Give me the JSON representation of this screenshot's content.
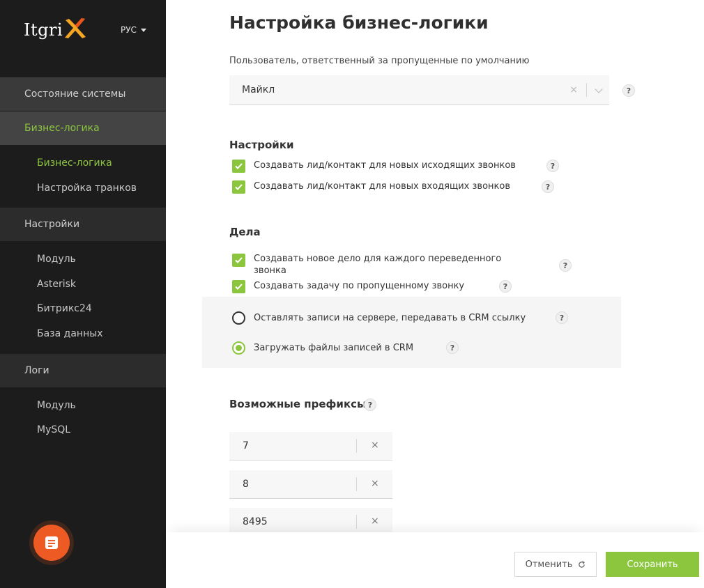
{
  "sidebar": {
    "logo_text": "Itgri",
    "lang": "РУС",
    "sections": {
      "state": "Состояние системы",
      "business": "Бизнес-логика",
      "settings": "Настройки",
      "logs": "Логи"
    },
    "business_items": [
      "Бизнес-логика",
      "Настройка транков"
    ],
    "settings_items": [
      "Модуль",
      "Asterisk",
      "Битрикс24",
      "База данных"
    ],
    "logs_items": [
      "Модуль",
      "MySQL"
    ],
    "colors": {
      "background": "#1c1c1c",
      "accent": "#8cc63f",
      "fab": "#ee5a24"
    }
  },
  "main": {
    "title": "Настройка бизнес-логики",
    "default_user": {
      "label": "Пользователь, ответственный за пропущенные по умолчанию",
      "value": "Майкл",
      "clear": "×"
    },
    "help_glyph": "?",
    "settings": {
      "heading": "Настройки",
      "checkboxes": [
        {
          "label": "Создавать лид/контакт для новых исходящих звонков",
          "checked": true
        },
        {
          "label": "Создавать лид/контакт для новых входящих звонков",
          "checked": true
        }
      ]
    },
    "deals": {
      "heading": "Дела",
      "checkboxes": [
        {
          "label": "Создавать новое дело для каждого переведенного звонка",
          "checked": true
        },
        {
          "label": "Создавать задачу по пропущенному звонку",
          "checked": true
        }
      ],
      "radios": [
        {
          "label": "Оставлять записи на сервере, передавать в CRM ссылку",
          "checked": false
        },
        {
          "label": "Загружать файлы записей в CRM",
          "checked": true
        }
      ]
    },
    "prefixes": {
      "heading": "Возможные префиксы",
      "items": [
        "7",
        "8",
        "8495"
      ],
      "remove": "×"
    }
  },
  "footer": {
    "cancel_label": "Отменить",
    "save_label": "Сохранить"
  }
}
